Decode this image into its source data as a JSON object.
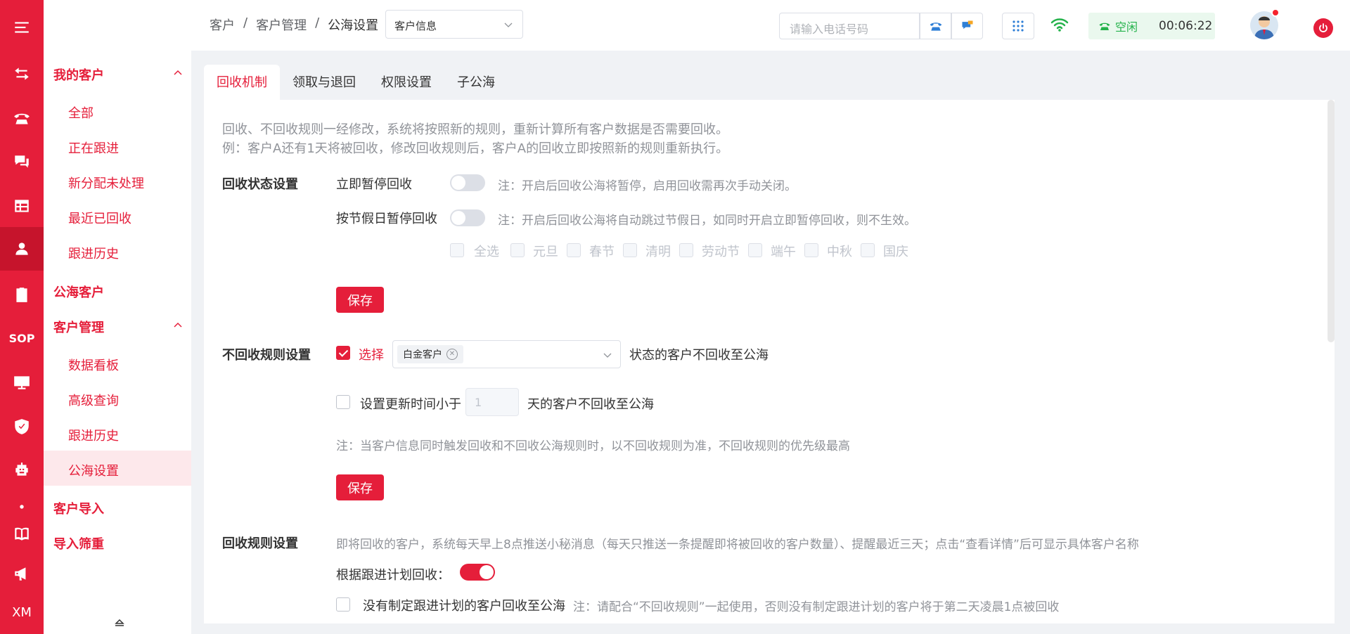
{
  "colors": {
    "primary": "#e51e3a",
    "status_green": "#24b24b"
  },
  "rail": {
    "items": [
      "menu-icon",
      "transfer-icon",
      "phone-icon",
      "chat-icon",
      "table-icon",
      "user-icon",
      "clipboard-icon",
      "sop-label",
      "monitor-icon",
      "shield-icon",
      "robot-icon",
      "dot",
      "book-icon",
      "megaphone-icon",
      "xm-label"
    ],
    "sop": "SOP",
    "xm": "XM"
  },
  "sidebar": {
    "my_customers": "我的客户",
    "my_items": [
      "全部",
      "正在跟进",
      "新分配未处理",
      "最近已回收",
      "跟进历史"
    ],
    "public_customers": "公海客户",
    "customer_mgmt": "客户管理",
    "mgmt_items": [
      "数据看板",
      "高级查询",
      "跟进历史",
      "公海设置"
    ],
    "customer_import": "客户导入",
    "import_filter": "导入筛重"
  },
  "header": {
    "breadcrumb": [
      "客户",
      "/",
      "客户管理",
      "/",
      "公海设置"
    ],
    "info_select": "客户信息",
    "phone_placeholder": "请输入电话号码",
    "status_label": "空闲",
    "timer": "00:06:22"
  },
  "tabs": [
    "回收机制",
    "领取与退回",
    "权限设置",
    "子公海"
  ],
  "recycle": {
    "intro1": "回收、不回收规则一经修改，系统将按照新的规则，重新计算所有客户数据是否需要回收。",
    "intro2": "例：客户A还有1天将被回收，修改回收规则后，客户A的回收立即按照新的规则重新执行。",
    "status_title": "回收状态设置",
    "pause_now_label": "立即暂停回收",
    "pause_now_note": "注：开启后回收公海将暂停，启用回收需再次手动关闭。",
    "pause_now_on": false,
    "holiday_label": "按节假日暂停回收",
    "holiday_note": "注：开启后回收公海将自动跳过节假日，如同时开启立即暂停回收，则不生效。",
    "holiday_on": false,
    "holidays": [
      "全选",
      "元旦",
      "春节",
      "清明",
      "劳动节",
      "端午",
      "中秋",
      "国庆"
    ],
    "save": "保存"
  },
  "norecycle": {
    "title": "不回收规则设置",
    "choose_label": "选择",
    "choose_checked": true,
    "tag": "白金客户",
    "suffix": "状态的客户不回收至公海",
    "update_label": "设置更新时间小于",
    "update_checked": false,
    "days_value": "1",
    "days_suffix": "天的客户不回收至公海",
    "note": "注：当客户信息同时触发回收和不回收公海规则时，以不回收规则为准，不回收规则的优先级最高",
    "save": "保存"
  },
  "rules": {
    "title": "回收规则设置",
    "desc": "即将回收的客户，系统每天早上8点推送小秘消息（每天只推送一条提醒即将被回收的客户数量）、提醒最近三天；点击“查看详情”后可显示具体客户名称",
    "plan_label": "根据跟进计划回收：",
    "plan_on": true,
    "noplan_label": "没有制定跟进计划的客户回收至公海",
    "noplan_checked": false,
    "noplan_note": "注：请配合“不回收规则”一起使用，否则没有制定跟进计划的客户将于第二天凌晨1点被回收"
  }
}
